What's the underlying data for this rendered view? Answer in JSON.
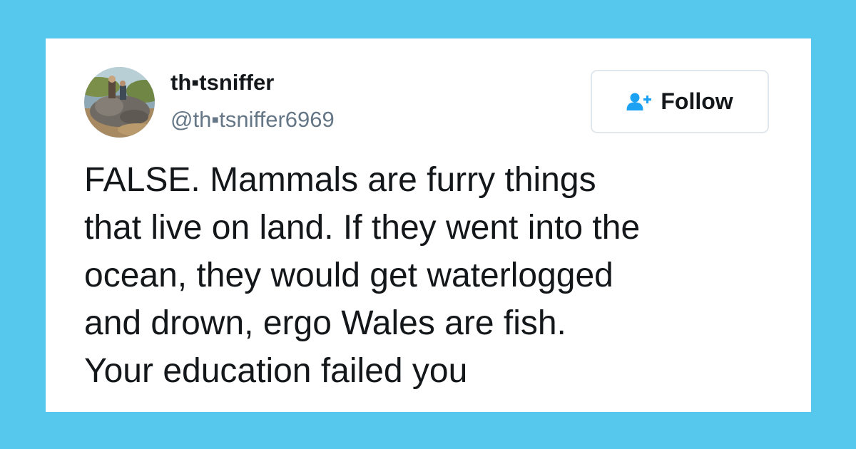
{
  "tweet": {
    "display_name": "th▪tsniffer",
    "handle": "@th▪tsniffer6969",
    "follow_label": "Follow",
    "follow_icon": "add-user-icon",
    "text_lines": [
      "FALSE. Mammals are furry things",
      "that live on land. If they went into the",
      "ocean, they would get waterlogged",
      "and drown, ergo Wales are fish.",
      "Your education failed you"
    ]
  },
  "colors": {
    "background": "#56c8ee",
    "card": "#ffffff",
    "text": "#14171a",
    "secondary_text": "#657786",
    "accent": "#1da1f2",
    "button_border": "#e1e8ed"
  }
}
